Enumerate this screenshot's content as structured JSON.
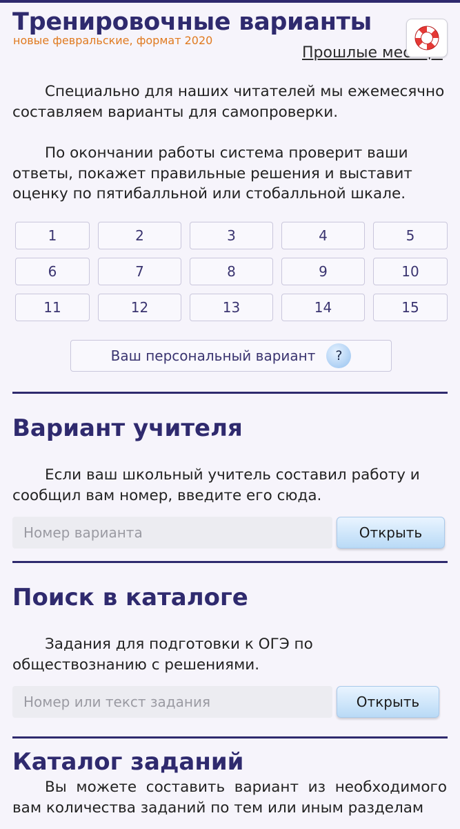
{
  "header": {
    "title": "Тренировочные варианты",
    "subtitle": "новые февральские, формат 2020",
    "past_link": "Прошлые месяцы",
    "help_icon": "lifebuoy-icon"
  },
  "intro": {
    "paragraph_1": "Специально для наших читателей мы ежемесячно составляем варианты для самопроверки.",
    "paragraph_2": "По окончании работы система проверит ваши ответы, покажет правильные решения и выставит оценку по пятибалльной или стобалльной шкале."
  },
  "variants": [
    "1",
    "2",
    "3",
    "4",
    "5",
    "6",
    "7",
    "8",
    "9",
    "10",
    "11",
    "12",
    "13",
    "14",
    "15"
  ],
  "personal_variant": {
    "label": "Ваш персональный вариант",
    "help_mark": "?"
  },
  "teacher": {
    "title": "Вариант учителя",
    "text": "Если ваш школьный учитель составил работу и сообщил вам номер, введите его сюда.",
    "input_placeholder": "Номер варианта",
    "button_label": "Открыть"
  },
  "catalog_search": {
    "title": "Поиск в каталоге",
    "text": "Задания для подготовки к ОГЭ по обществознанию с решениями.",
    "input_placeholder": "Номер или текст задания",
    "button_label": "Открыть"
  },
  "catalog": {
    "title": "Каталог заданий",
    "text": "Вы можете составить вариант из необходимого вам количества заданий по тем или иным разделам"
  },
  "colors": {
    "accent": "#2f2a6e",
    "subtitle": "#e07a1f",
    "background": "#f6f4fb",
    "button_blue": "#b9daf6"
  }
}
